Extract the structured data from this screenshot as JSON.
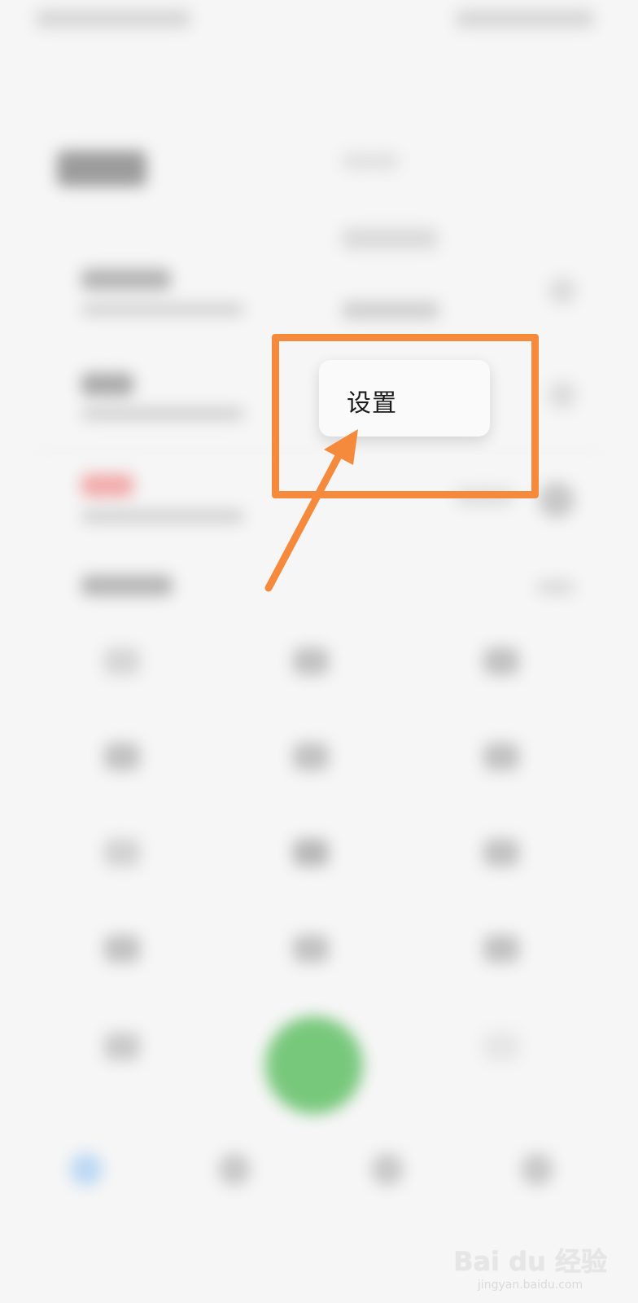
{
  "popup_menu": {
    "items": [
      {
        "label": "设置"
      }
    ]
  },
  "colors": {
    "annotation": "#f58a3c",
    "call_button": "#78c87c"
  },
  "watermark": {
    "brand": "Bai du 经验",
    "url": "jingyan.baidu.com"
  }
}
